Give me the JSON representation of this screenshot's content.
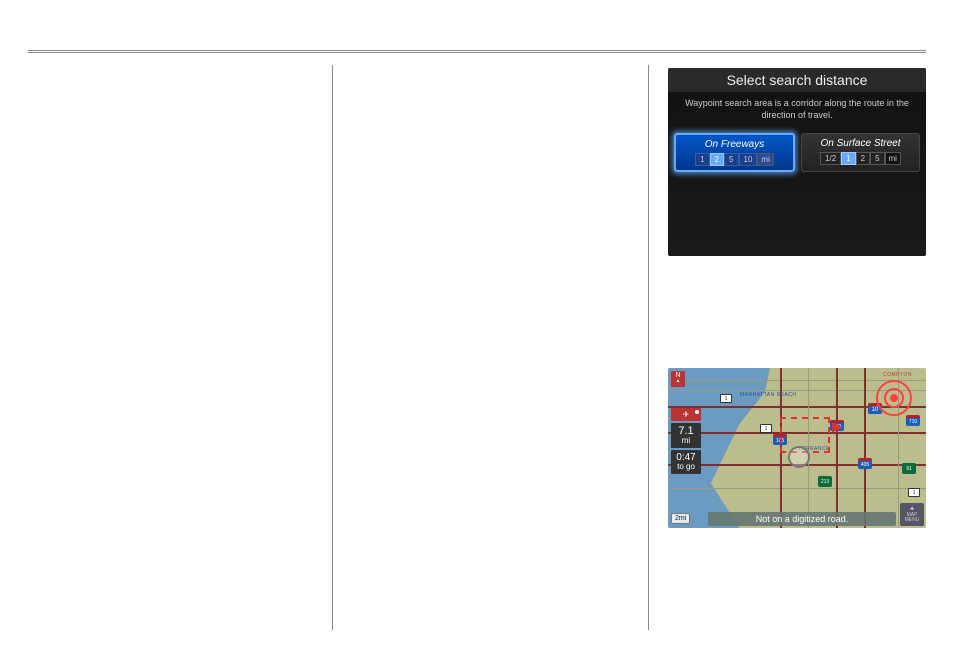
{
  "top_panel": {
    "title": "Select search distance",
    "description": "Waypoint search area is a corridor along the route in the direction of travel.",
    "option_a": {
      "label": "On Freeways",
      "distances": [
        "1",
        "2",
        "5",
        "10"
      ],
      "unit": "mi",
      "selected": "2"
    },
    "option_b": {
      "label": "On Surface Street",
      "distances": [
        "1/2",
        "1",
        "2",
        "5"
      ],
      "unit": "mi",
      "selected": "1"
    }
  },
  "map": {
    "north": "N",
    "hud": {
      "trip_dist": "7.1",
      "trip_dist_unit": "mi",
      "trip_time": "0:47",
      "trip_time_label": "to go"
    },
    "scale": "2mi",
    "status": "Not on a digitized road.",
    "menu_label": "MAP MENU",
    "shields": {
      "sr1_a": "1",
      "sr1_b": "1",
      "sr1_c": "1",
      "i110": "110",
      "i405": "405",
      "i10": "10",
      "i710": "710",
      "i105": "105",
      "sr91": "91",
      "sr213": "213"
    },
    "cities": {
      "mb": "MANHATTAN BEACH",
      "torrance": "TORRANCE",
      "compton": "COMPTON"
    }
  }
}
